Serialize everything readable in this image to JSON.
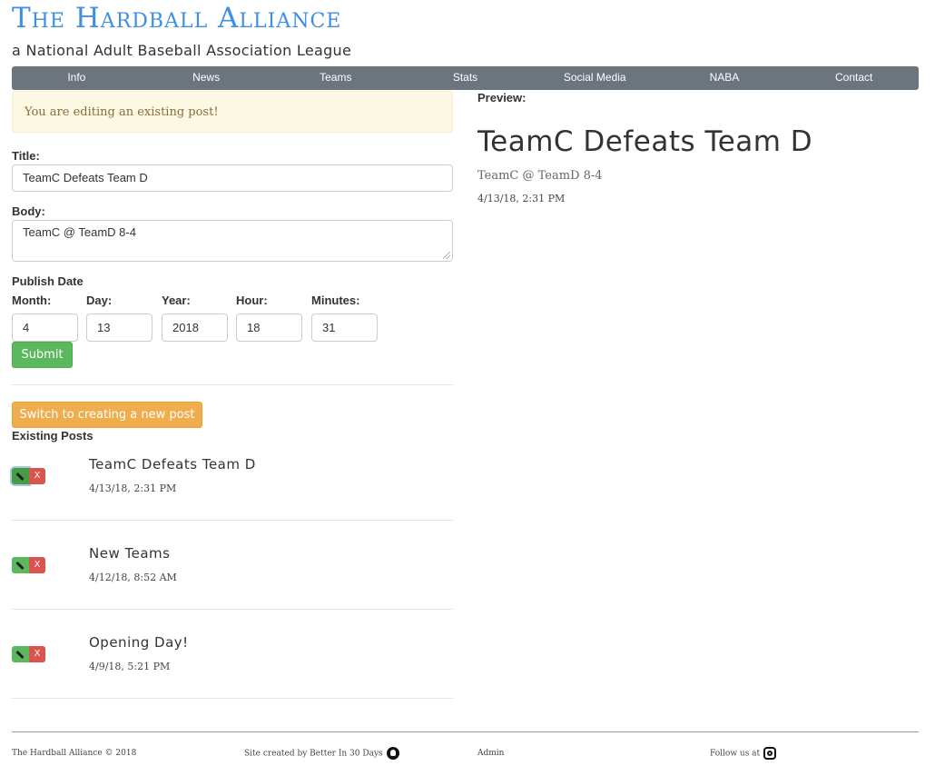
{
  "header": {
    "site_title": "The Hardball Alliance",
    "subtitle": "a National Adult Baseball Association League"
  },
  "nav": {
    "items": [
      "Info",
      "News",
      "Teams",
      "Stats",
      "Social Media",
      "NABA",
      "Contact"
    ]
  },
  "editor": {
    "alert": "You are editing an existing post!",
    "title_label": "Title:",
    "title_value": "TeamC Defeats Team D",
    "body_label": "Body:",
    "body_value": "TeamC @ TeamD 8-4",
    "publish_label": "Publish Date",
    "month_label": "Month:",
    "day_label": "Day:",
    "year_label": "Year:",
    "hour_label": "Hour:",
    "minutes_label": "Minutes:",
    "month_value": "4",
    "day_value": "13",
    "year_value": "2018",
    "hour_value": "18",
    "minutes_value": "31",
    "submit_label": "Submit",
    "switch_label": "Switch to creating a new post"
  },
  "existing": {
    "heading": "Existing Posts",
    "delete_label": "X",
    "posts": [
      {
        "title": "TeamC Defeats Team D",
        "date": "4/13/18, 2:31 PM"
      },
      {
        "title": "New Teams",
        "date": "4/12/18, 8:52 AM"
      },
      {
        "title": "Opening Day!",
        "date": "4/9/18, 5:21 PM"
      }
    ]
  },
  "preview": {
    "label": "Preview:",
    "title": "TeamC Defeats Team D",
    "body": "TeamC @ TeamD 8-4",
    "date": "4/13/18, 2:31 PM"
  },
  "footer": {
    "copyright": "The Hardball Alliance © 2018",
    "credit_prefix": "Site created by",
    "credit_name": "Better In 30 Days",
    "admin": "Admin",
    "follow": "Follow us at"
  },
  "icons": {
    "edit": "pencil-icon",
    "github": "github-icon",
    "instagram": "instagram-icon"
  },
  "colors": {
    "title_blue": "#3f8fe0",
    "nav_gray": "#6c757d",
    "success_green": "#5cb85c",
    "warning_orange": "#f0ad4e",
    "danger_red": "#d9534f",
    "alert_bg": "#fcf8e3"
  }
}
